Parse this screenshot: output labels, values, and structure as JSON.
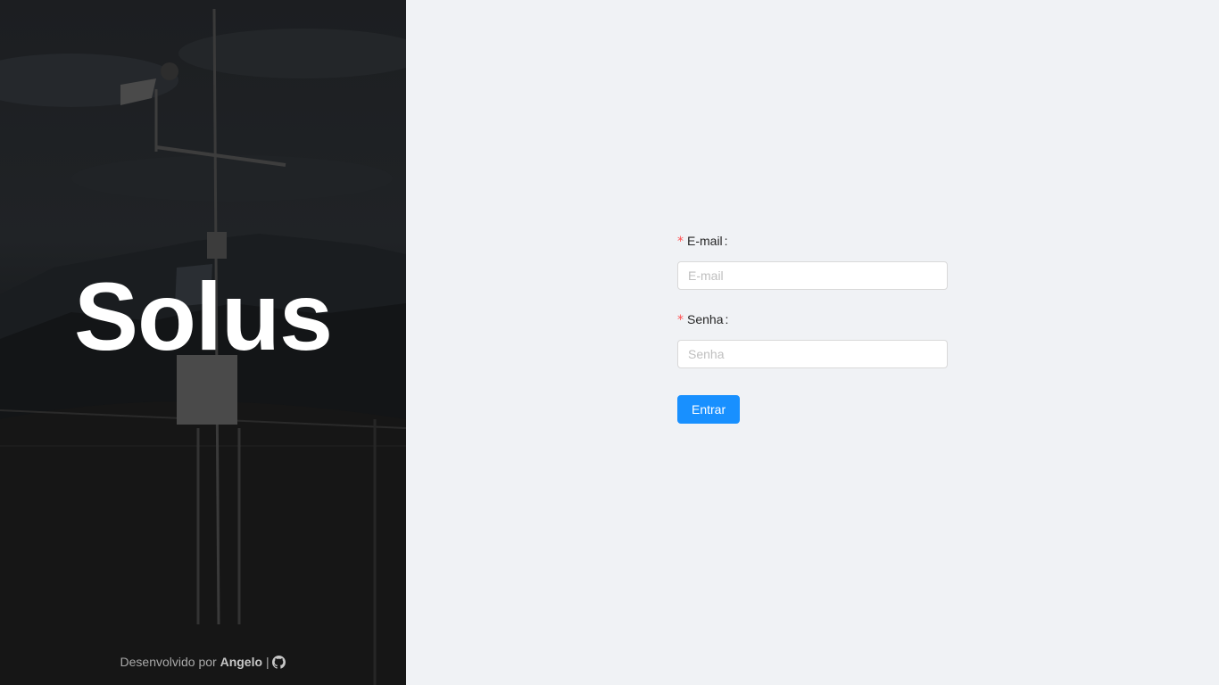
{
  "hero": {
    "title": "Solus",
    "footer": {
      "prefix": "Desenvolvido por",
      "author": "Angelo",
      "separator": "|",
      "link_icon": "github-icon"
    }
  },
  "login_form": {
    "email": {
      "label": "E-mail",
      "placeholder": "E-mail",
      "required": true,
      "value": ""
    },
    "password": {
      "label": "Senha",
      "placeholder": "Senha",
      "required": true,
      "value": ""
    },
    "required_mark": "*",
    "colon": ":",
    "submit_label": "Entrar"
  },
  "colors": {
    "primary": "#1890ff",
    "required": "#ff4d4f",
    "panel_background": "#f0f2f5"
  }
}
